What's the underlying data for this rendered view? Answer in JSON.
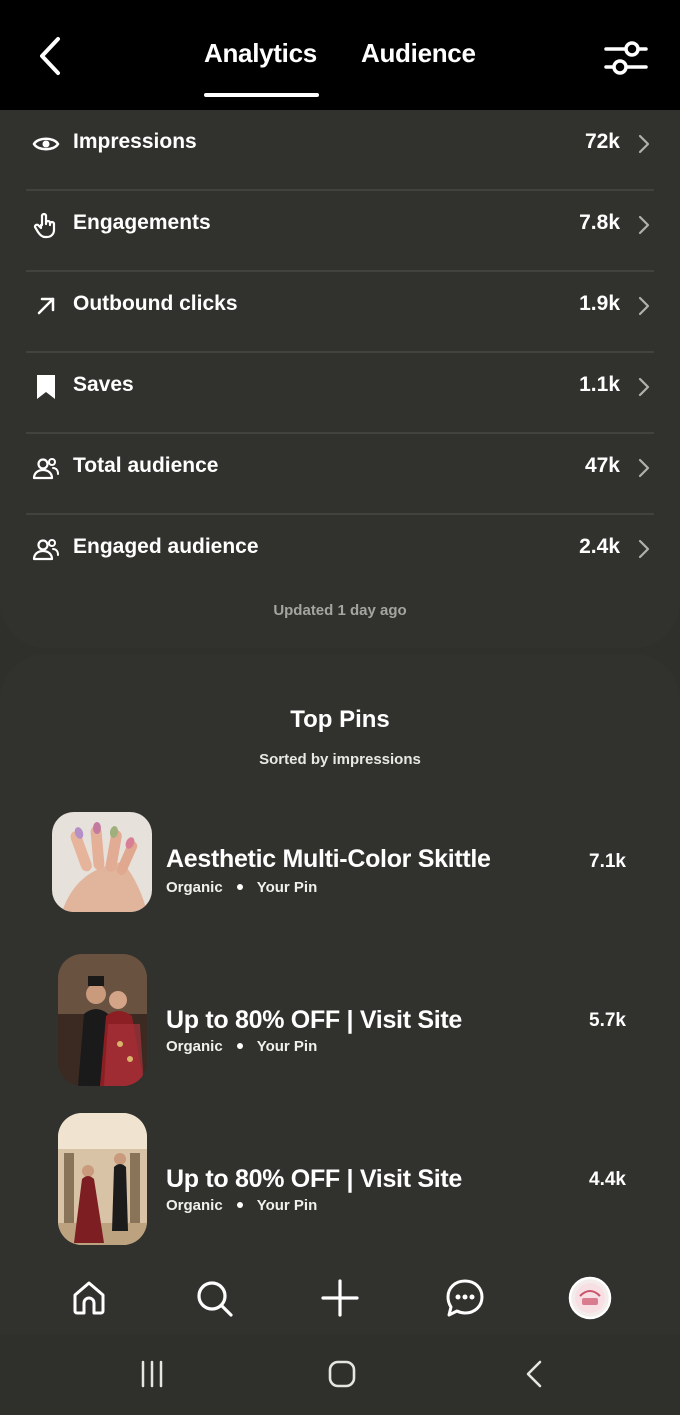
{
  "header": {
    "tabs": [
      {
        "label": "Analytics",
        "active": true
      },
      {
        "label": "Audience",
        "active": false
      }
    ],
    "back_icon": "chevron-left-icon",
    "filter_icon": "sliders-icon"
  },
  "metrics": [
    {
      "label": "Impressions",
      "value": "72k",
      "icon": "eye-icon"
    },
    {
      "label": "Engagements",
      "value": "7.8k",
      "icon": "tap-hand-icon"
    },
    {
      "label": "Outbound clicks",
      "value": "1.9k",
      "icon": "arrow-up-right-icon"
    },
    {
      "label": "Saves",
      "value": "1.1k",
      "icon": "bookmark-icon"
    },
    {
      "label": "Total audience",
      "value": "47k",
      "icon": "people-icon"
    },
    {
      "label": "Engaged audience",
      "value": "2.4k",
      "icon": "people-icon"
    }
  ],
  "updated_text": "Updated 1 day ago",
  "top_pins": {
    "title": "Top Pins",
    "subtitle": "Sorted by impressions",
    "items": [
      {
        "title": "Aesthetic Multi-Color Skittle",
        "source": "Organic",
        "owner": "Your Pin",
        "count": "7.1k"
      },
      {
        "title": "Up to 80% OFF | Visit Site",
        "source": "Organic",
        "owner": "Your Pin",
        "count": "5.7k"
      },
      {
        "title": "Up to 80% OFF | Visit Site",
        "source": "Organic",
        "owner": "Your Pin",
        "count": "4.4k"
      }
    ]
  },
  "bottom_nav": [
    "home-icon",
    "search-icon",
    "plus-icon",
    "chat-icon",
    "profile-avatar"
  ],
  "system_nav": [
    "recents-icon",
    "home-circle-icon",
    "back-icon"
  ],
  "colors": {
    "background": "#2f302c",
    "header": "#000000",
    "divider": "#42433e",
    "muted_text": "#a4a59f"
  }
}
